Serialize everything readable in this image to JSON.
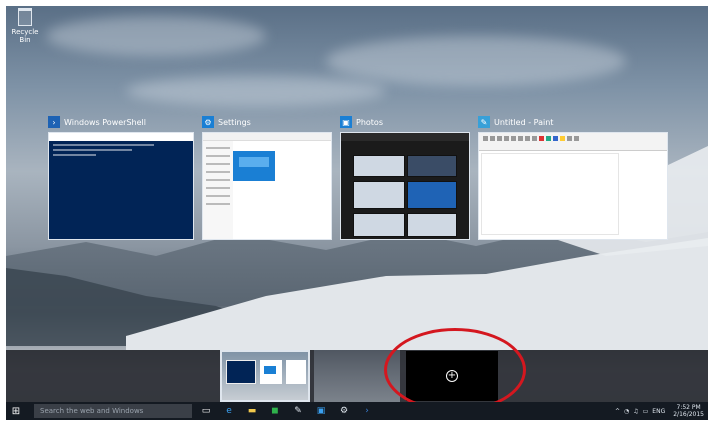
{
  "desktop": {
    "recycle_bin_label": "Recycle Bin"
  },
  "windows": [
    {
      "title": "Windows PowerShell",
      "icon": "powershell-icon",
      "color": "#1d62b4"
    },
    {
      "title": "Settings",
      "icon": "gear-icon",
      "color": "#1a7fd4"
    },
    {
      "title": "Photos",
      "icon": "photos-icon",
      "color": "#1a7fd4"
    },
    {
      "title": "Untitled - Paint",
      "icon": "paint-icon",
      "color": "#38a0d8"
    }
  ],
  "task_view": {
    "new_desktop_symbol": "+"
  },
  "taskbar": {
    "start_symbol": "⊞",
    "search_placeholder": "Search the web and Windows",
    "icons": [
      "task-view-icon",
      "edge-icon",
      "file-explorer-icon",
      "store-icon",
      "paint-icon",
      "photos-icon",
      "settings-icon",
      "powershell-icon"
    ],
    "tray_glyphs": [
      "^",
      "◔",
      "♫",
      "▭",
      "ENG"
    ],
    "time": "7:52 PM",
    "date": "2/16/2015"
  },
  "colors": {
    "highlight_circle": "#d4171f",
    "taskbar": "#141a22",
    "powershell_bg": "#012456"
  }
}
